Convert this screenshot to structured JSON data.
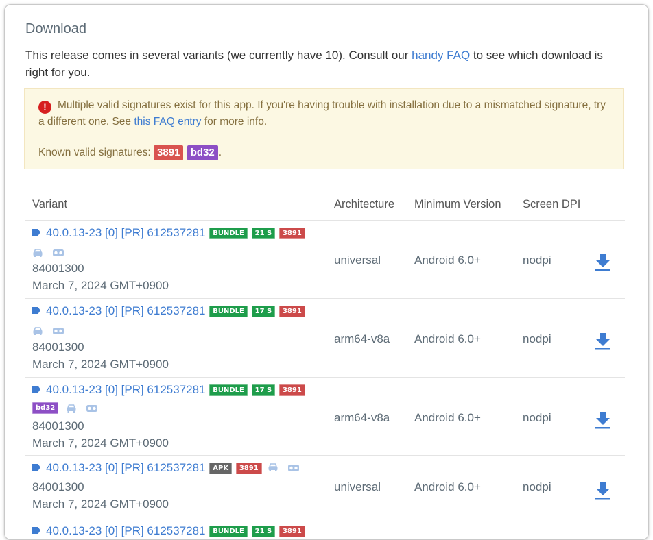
{
  "section": {
    "title": "Download",
    "intro_before": "This release comes in several variants (we currently have 10). Consult our ",
    "intro_link": "handy FAQ",
    "intro_after": " to see which download is right for you."
  },
  "alert": {
    "text_before": "Multiple valid signatures exist for this app. If you're having trouble with installation due to a mismatched signature, try a different one. See ",
    "link": "this FAQ entry",
    "text_after": " for more info.",
    "signatures_label": "Known valid signatures: ",
    "signatures": [
      "3891",
      "bd32"
    ],
    "signatures_end": ".",
    "icon": "exclamation-circle-icon",
    "icon_glyph": "!"
  },
  "table": {
    "headers": [
      "Variant",
      "Architecture",
      "Minimum Version",
      "Screen DPI"
    ],
    "rows": [
      {
        "name": "40.0.13-23 [0] [PR] 612537281",
        "badges": [
          "BUNDLE",
          "21 S",
          "3891"
        ],
        "version_code": "84001300",
        "date": "March 7, 2024 GMT+0900",
        "arch": "universal",
        "min_version": "Android 6.0+",
        "dpi": "nodpi"
      },
      {
        "name": "40.0.13-23 [0] [PR] 612537281",
        "badges": [
          "BUNDLE",
          "17 S",
          "3891"
        ],
        "version_code": "84001300",
        "date": "March 7, 2024 GMT+0900",
        "arch": "arm64-v8a",
        "min_version": "Android 6.0+",
        "dpi": "nodpi"
      },
      {
        "name": "40.0.13-23 [0] [PR] 612537281",
        "badges": [
          "BUNDLE",
          "17 S",
          "3891"
        ],
        "extra_badge": "bd32",
        "version_code": "84001300",
        "date": "March 7, 2024 GMT+0900",
        "arch": "arm64-v8a",
        "min_version": "Android 6.0+",
        "dpi": "nodpi"
      },
      {
        "name": "40.0.13-23 [0] [PR] 612537281",
        "badges": [
          "APK",
          "3891"
        ],
        "version_code": "84001300",
        "date": "March 7, 2024 GMT+0900",
        "arch": "universal",
        "min_version": "Android 6.0+",
        "dpi": "nodpi"
      }
    ]
  },
  "colors": {
    "link": "#3e7cd1",
    "alert_bg": "#fcf8e3",
    "badge_green": "#1e9d4b",
    "badge_red": "#cc4a4a",
    "badge_grey": "#666666",
    "badge_purple": "#8d4fc5"
  },
  "icons": {
    "row_tag": "tag-icon",
    "car": "android-auto-icon",
    "vr": "vr-headset-icon",
    "download": "download-icon"
  }
}
